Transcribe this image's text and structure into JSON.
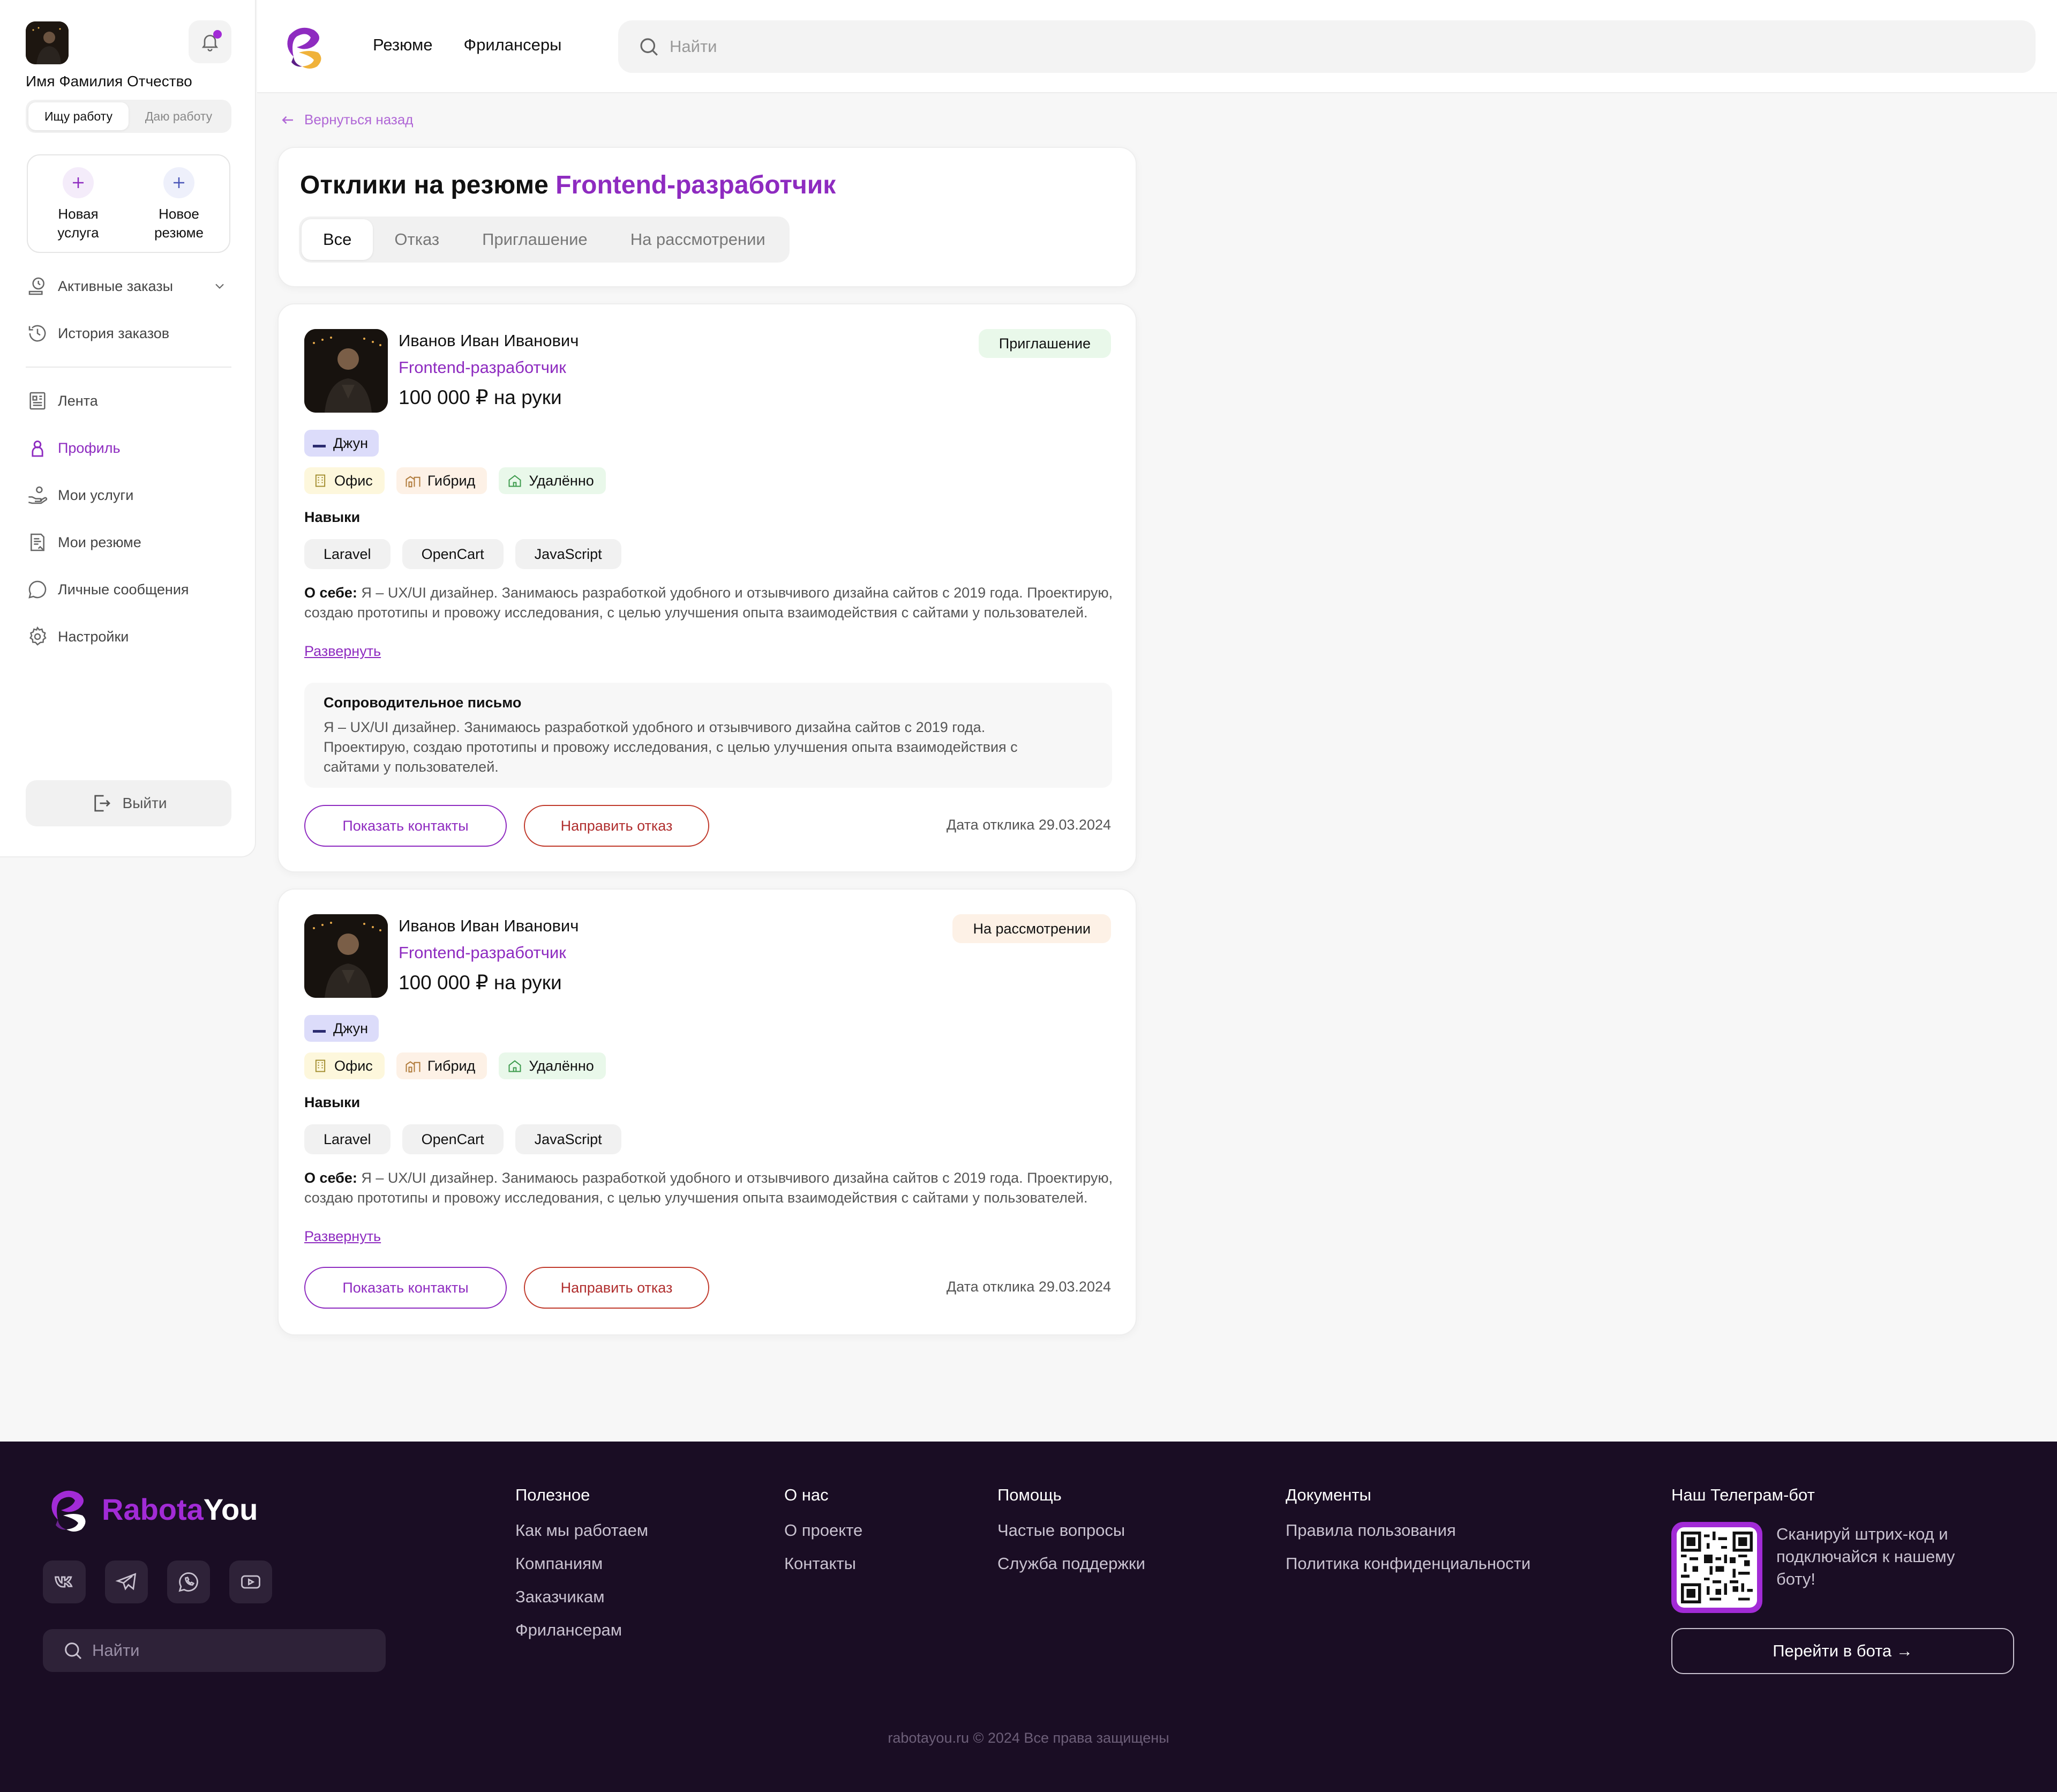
{
  "sidebar": {
    "user_name": "Имя Фамилия Отчество",
    "mode": {
      "seek_label": "Ищу работу",
      "give_label": "Даю работу",
      "active": "seek"
    },
    "quick_actions": [
      {
        "label": "Новая услуга"
      },
      {
        "label": "Новое резюме"
      }
    ],
    "nav_top": [
      {
        "label": "Активные заказы",
        "icon": "clipboard-clock-icon"
      },
      {
        "label": "История заказов",
        "icon": "history-icon"
      }
    ],
    "nav_main": [
      {
        "label": "Лента",
        "icon": "feed-icon"
      },
      {
        "label": "Профиль",
        "icon": "user-icon",
        "active": true
      },
      {
        "label": "Мои услуги",
        "icon": "hand-services-icon"
      },
      {
        "label": "Мои резюме",
        "icon": "resume-icon"
      },
      {
        "label": "Личные сообщения",
        "icon": "chat-icon"
      },
      {
        "label": "Настройки",
        "icon": "gear-icon"
      }
    ],
    "logout_label": "Выйти"
  },
  "header": {
    "nav": [
      "Резюме",
      "Фрилансеры"
    ],
    "search_placeholder": "Найти"
  },
  "main": {
    "back_label": "Вернуться назад",
    "title_prefix": "Отклики на резюме",
    "title_accent": "Frontend-разработчик",
    "tabs": [
      {
        "label": "Все",
        "active": true
      },
      {
        "label": "Отказ"
      },
      {
        "label": "Приглашение"
      },
      {
        "label": "На рассмотрении"
      }
    ],
    "responses": [
      {
        "name": "Иванов Иван Иванович",
        "role": "Frontend-разработчик",
        "salary": "100 000 ₽ на руки",
        "status": "Приглашение",
        "status_color": "#e9f8ea",
        "level": "Джун",
        "formats": [
          "Офис",
          "Гибрид",
          "Удалённо"
        ],
        "skills_title": "Навыки",
        "skills": [
          "Laravel",
          "OpenCart",
          "JavaScript"
        ],
        "about_label": "О себе:",
        "about_text": "Я – UX/UI дизайнер. Занимаюсь разработкой удобного и отзывчивого дизайна сайтов с 2019 года. Проектирую, создаю прототипы и провожу исследования, с целью улучшения опыта взаимодействия с сайтами у пользователей.",
        "expand_label": "Развернуть",
        "cover_title": "Сопроводительное письмо",
        "cover_text": "Я – UX/UI дизайнер. Занимаюсь разработкой удобного и отзывчивого дизайна сайтов с 2019 года. Проектирую, создаю прототипы и провожу исследования, с целью улучшения опыта взаимодействия с сайтами у пользователей.",
        "show_contacts": "Показать контакты",
        "reject": "Направить отказ",
        "date": "Дата отклика 29.03.2024"
      },
      {
        "name": "Иванов Иван Иванович",
        "role": "Frontend-разработчик",
        "salary": "100 000 ₽ на руки",
        "status": "На рассмотрении",
        "status_color": "#fdf1e6",
        "level": "Джун",
        "formats": [
          "Офис",
          "Гибрид",
          "Удалённо"
        ],
        "skills_title": "Навыки",
        "skills": [
          "Laravel",
          "OpenCart",
          "JavaScript"
        ],
        "about_label": "О себе:",
        "about_text": "Я – UX/UI дизайнер. Занимаюсь разработкой удобного и отзывчивого дизайна сайтов с 2019 года. Проектирую, создаю прототипы и провожу исследования, с целью улучшения опыта взаимодействия с сайтами у пользователей.",
        "expand_label": "Развернуть",
        "show_contacts": "Показать контакты",
        "reject": "Направить отказ",
        "date": "Дата отклика 29.03.2024"
      }
    ]
  },
  "footer": {
    "brand_part1": "Rabota",
    "brand_part2": "You",
    "socials": [
      "vk-icon",
      "telegram-icon",
      "whatsapp-icon",
      "youtube-icon"
    ],
    "search_placeholder": "Найти",
    "columns": [
      {
        "title": "Полезное",
        "links": [
          "Как мы работаем",
          "Компаниям",
          "Заказчикам",
          "Фрилансерам"
        ]
      },
      {
        "title": "О нас",
        "links": [
          "О проекте",
          "Контакты"
        ]
      },
      {
        "title": "Помощь",
        "links": [
          "Частые вопросы",
          "Служба поддержки"
        ]
      },
      {
        "title": "Документы",
        "links": [
          "Правила пользования",
          "Политика конфиденциальности"
        ]
      }
    ],
    "telegram_title": "Наш Телеграм-бот",
    "telegram_text": "Сканируй штрих-код и подключайся к нашему боту!",
    "telegram_button": "Перейти в бота →",
    "copyright": "rabotayou.ru © 2024 Все права защищены"
  },
  "colors": {
    "accent": "#8e2bc0",
    "reject": "#b02e2e",
    "footer_bg": "#1a0d24"
  }
}
